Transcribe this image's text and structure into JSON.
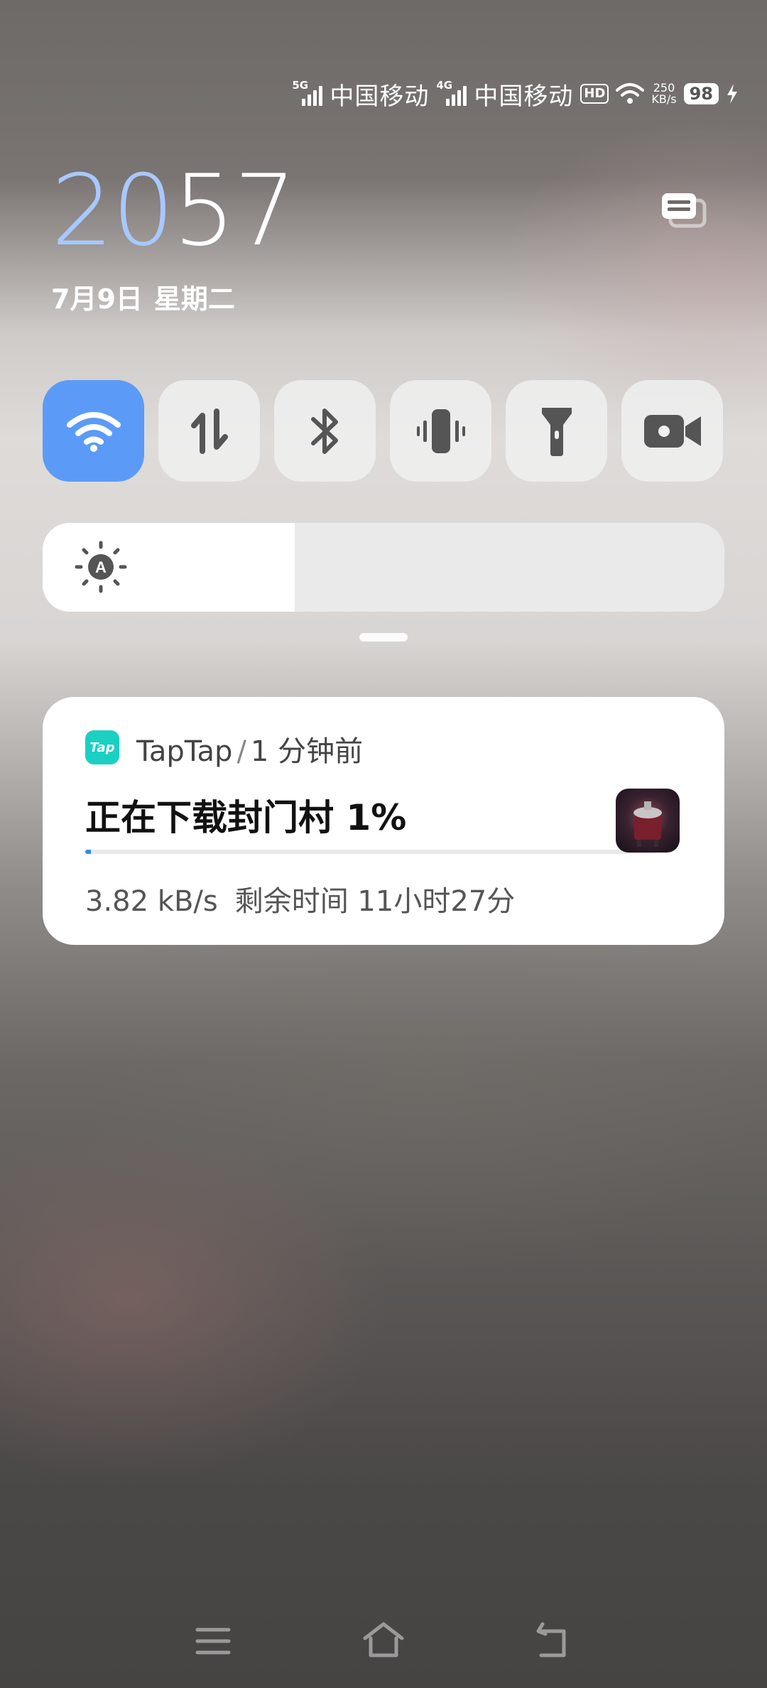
{
  "status_bar": {
    "sim1": {
      "network": "5G",
      "carrier": "中国移动"
    },
    "sim2": {
      "network": "4G",
      "carrier": "中国移动"
    },
    "hd_badge": "HD",
    "net_speed_value": "250",
    "net_speed_unit": "KB/s",
    "battery": "98"
  },
  "clock": {
    "hours": "20",
    "minutes": "57"
  },
  "date": {
    "date_text": "7月9日",
    "weekday": "星期二"
  },
  "quick_toggles": [
    {
      "name": "wifi",
      "active": true
    },
    {
      "name": "mobile-data",
      "active": false
    },
    {
      "name": "bluetooth",
      "active": false
    },
    {
      "name": "vibrate",
      "active": false
    },
    {
      "name": "flashlight",
      "active": false
    },
    {
      "name": "screen-record",
      "active": false
    }
  ],
  "brightness": {
    "auto_icon_label": "A",
    "level": 0.37
  },
  "notification": {
    "app_icon_text": "Tap",
    "app_name": "TapTap",
    "separator": "/",
    "time": "1 分钟前",
    "title": "正在下载封门村 1%",
    "progress": 0.01,
    "speed": "3.82 kB/s",
    "remaining": "剩余时间 11小时27分"
  },
  "colors": {
    "accent": "#5b9bf7",
    "clock_hours": "#a8c8ff",
    "taptap": "#19d0c2",
    "progress": "#3a86e8"
  }
}
